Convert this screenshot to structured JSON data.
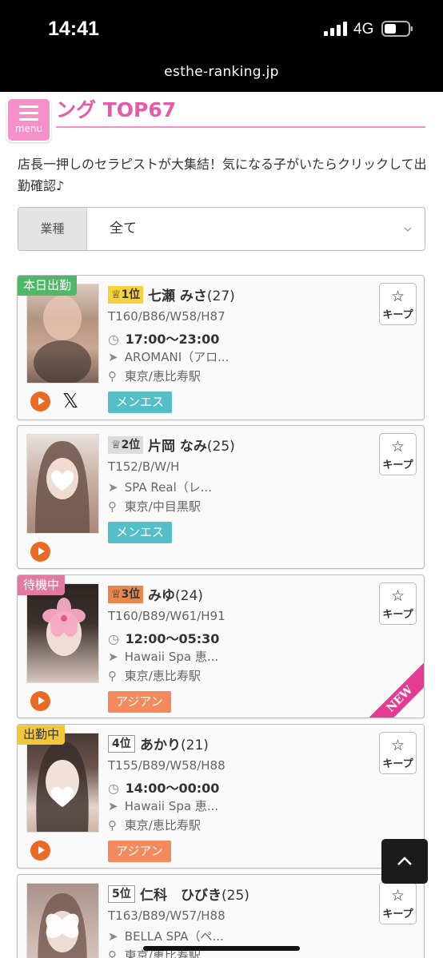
{
  "status_bar": {
    "time": "14:41",
    "network": "4G",
    "url": "esthe-ranking.jp"
  },
  "header": {
    "menu_label": "menu",
    "title": "ング TOP67"
  },
  "intro_text": "店長一押しのセラピストが大集結！気になる子がいたらクリックして出勤確認♪",
  "filter": {
    "label": "業種",
    "value": "全て"
  },
  "keep_label": "キープ",
  "new_label": "NEW",
  "colors": {
    "pink": "#e85aa8",
    "teal": "#55bfc9",
    "orange": "#f28a5e",
    "tag_green": "#4fb866",
    "tag_pink": "#e07aa0",
    "tag_yellow": "#f2c73b",
    "rank_gold": "#f7d23d",
    "rank_silver": "#dcdcdc",
    "rank_bronze": "#e9874a"
  },
  "cards": [
    {
      "tag": "本日出勤",
      "rank": "1位",
      "name": "七瀬 みさ",
      "age": "(27)",
      "size": "T160/B86/W58/H87",
      "time": "17:00〜23:00",
      "shop": "AROMANI（アロ...",
      "area": "東京/恵比寿駅",
      "genre": "メンエス",
      "has_x": true
    },
    {
      "tag": "",
      "rank": "2位",
      "name": "片岡 なみ",
      "age": "(25)",
      "size": "T152/B/W/H",
      "time": "",
      "shop": "SPA Real（レ...",
      "area": "東京/中目黒駅",
      "genre": "メンエス",
      "has_x": false
    },
    {
      "tag": "待機中",
      "rank": "3位",
      "name": "みゆ",
      "age": "(24)",
      "size": "T160/B89/W61/H91",
      "time": "12:00〜05:30",
      "shop": "Hawaii Spa 恵...",
      "area": "東京/恵比寿駅",
      "genre": "アジアン",
      "has_x": false,
      "is_new": true
    },
    {
      "tag": "出勤中",
      "rank": "4位",
      "name": "あかり",
      "age": "(21)",
      "size": "T155/B89/W58/H88",
      "time": "14:00〜00:00",
      "shop": "Hawaii Spa 恵...",
      "area": "東京/恵比寿駅",
      "genre": "アジアン",
      "has_x": false
    },
    {
      "tag": "",
      "rank": "5位",
      "name": "仁科　ひびき",
      "age": "(25)",
      "size": "T163/B89/W57/H88",
      "time": "",
      "shop": "BELLA SPA（ペ...",
      "area": "東京/恵比寿駅",
      "genre": "",
      "has_x": false
    }
  ]
}
